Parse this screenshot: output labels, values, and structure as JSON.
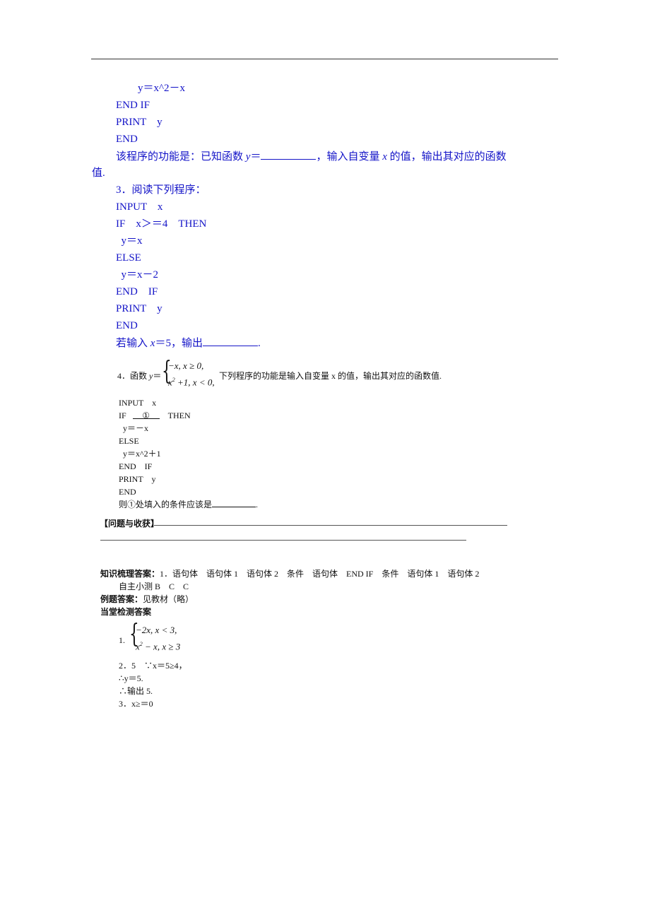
{
  "part_two": {
    "code_tail": [
      "y＝x^2－x",
      "END IF",
      "PRINT　y",
      "END"
    ],
    "question_prefix": "该程序的功能是：已知函数 ",
    "question_var": "y",
    "question_eq": "＝",
    "question_suffix": "，输入自变量 ",
    "question_x": "x",
    "question_suffix2": " 的值，输出其对应的函数",
    "question_wrap": "值."
  },
  "part_three": {
    "heading": "3．阅读下列程序：",
    "code": [
      "INPUT　x",
      "IF　x＞＝4　THEN",
      "  y＝x",
      "ELSE",
      "  y＝x－2",
      "END　IF",
      "PRINT　y",
      "END"
    ],
    "question_prefix": "若输入 ",
    "question_var": "x",
    "question_mid": "＝5，输出",
    "question_end": "."
  },
  "part_four": {
    "label": "4．函数 ",
    "func_var": "y",
    "func_eq": "＝",
    "case1": "−x, x ≥ 0,",
    "case2_base": "x",
    "case2_exp": "2",
    "case2_rest": " +1, x < 0,",
    "description": "下列程序的功能是输入自变量 x 的值，输出其对应的函数值.",
    "code_input": "INPUT　x",
    "code_if": "IF",
    "code_blank": "①",
    "code_then": "THEN",
    "code_rest": [
      "  y＝－x",
      "ELSE",
      "  y＝x^2＋1",
      "END　IF",
      "PRINT　y",
      "END"
    ],
    "question_prefix": "则①处填入的条件应该是",
    "question_end": "."
  },
  "reflection": {
    "label": "【问题与收获】"
  },
  "answers": {
    "knowledge_label": "知识梳理答案：",
    "knowledge_text": "1．语句体　语句体 1　语句体 2　条件　语句体　END IF　条件　语句体 1　语句体 2",
    "self_test": "自主小测 B　C　C",
    "example_label": "例题答案：",
    "example_text": "见教材（略）",
    "check_label": "当堂检测答案",
    "a1_label": "1.",
    "a1_case1": "−2x, x < 3,",
    "a1_case2_base": "x",
    "a1_case2_exp": "2",
    "a1_case2_rest": " − x, x ≥ 3",
    "a2_line1": "2．5　∵x＝5≥4，",
    "a2_line2": "∴y＝5.",
    "a2_line3": "∴输出 5.",
    "a3": "3．x≥＝0"
  }
}
